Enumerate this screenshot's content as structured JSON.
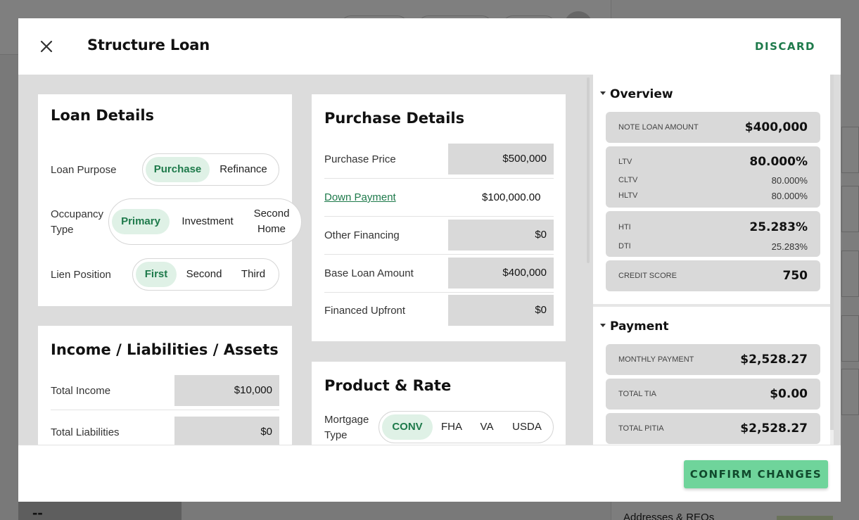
{
  "modal": {
    "title": "Structure Loan",
    "discard_label": "DISCARD",
    "confirm_label": "CONFIRM CHANGES"
  },
  "loan_details": {
    "title": "Loan Details",
    "loan_purpose": {
      "label": "Loan Purpose",
      "options": [
        "Purchase",
        "Refinance"
      ],
      "selected": "Purchase"
    },
    "occupancy_type": {
      "label_line1": "Occupancy",
      "label_line2": "Type",
      "options": [
        "Primary",
        "Investment",
        "Second Home"
      ],
      "option3_line1": "Second",
      "option3_line2": "Home",
      "selected": "Primary"
    },
    "lien_position": {
      "label": "Lien Position",
      "options": [
        "First",
        "Second",
        "Third"
      ],
      "selected": "First"
    }
  },
  "income": {
    "title": "Income / Liabilities / Assets",
    "rows": [
      {
        "label": "Total Income",
        "value": "$10,000"
      },
      {
        "label": "Total Liabilities",
        "value": "$0"
      }
    ]
  },
  "purchase_details": {
    "title": "Purchase Details",
    "rows": [
      {
        "label": "Purchase Price",
        "value": "$500,000"
      },
      {
        "label": "Down Payment",
        "value": "$100,000.00"
      },
      {
        "label": "Other Financing",
        "value": "$0"
      },
      {
        "label": "Base Loan Amount",
        "value": "$400,000"
      },
      {
        "label": "Financed Upfront",
        "value": "$0"
      }
    ]
  },
  "product_rate": {
    "title": "Product & Rate",
    "mortgage_type": {
      "label_line1": "Mortgage",
      "label_line2": "Type",
      "options": [
        "CONV",
        "FHA",
        "VA",
        "USDA"
      ],
      "selected": "CONV"
    }
  },
  "overview": {
    "title": "Overview",
    "note_loan_amount": {
      "label": "NOTE LOAN AMOUNT",
      "value": "$400,000"
    },
    "ltv": {
      "label": "LTV",
      "value": "80.000%"
    },
    "cltv": {
      "label": "CLTV",
      "value": "80.000%"
    },
    "hltv": {
      "label": "HLTV",
      "value": "80.000%"
    },
    "hti": {
      "label": "HTI",
      "value": "25.283%"
    },
    "dti": {
      "label": "DTI",
      "value": "25.283%"
    },
    "credit_score": {
      "label": "CREDIT SCORE",
      "value": "750"
    }
  },
  "payment": {
    "title": "Payment",
    "monthly_payment": {
      "label": "MONTHLY PAYMENT",
      "value": "$2,528.27"
    },
    "total_tia": {
      "label": "TOTAL TIA",
      "value": "$0.00"
    },
    "total_pitia": {
      "label": "TOTAL PITIA",
      "value": "$2,528.27"
    }
  },
  "background": {
    "addresses_label": "Addresses & REOs",
    "dash": "--"
  },
  "colors": {
    "accent": "#1e7a4b",
    "toggle_active_bg": "#dff1e6",
    "confirm_bg": "#6fd49b",
    "field_bg": "#d9d9d9"
  }
}
